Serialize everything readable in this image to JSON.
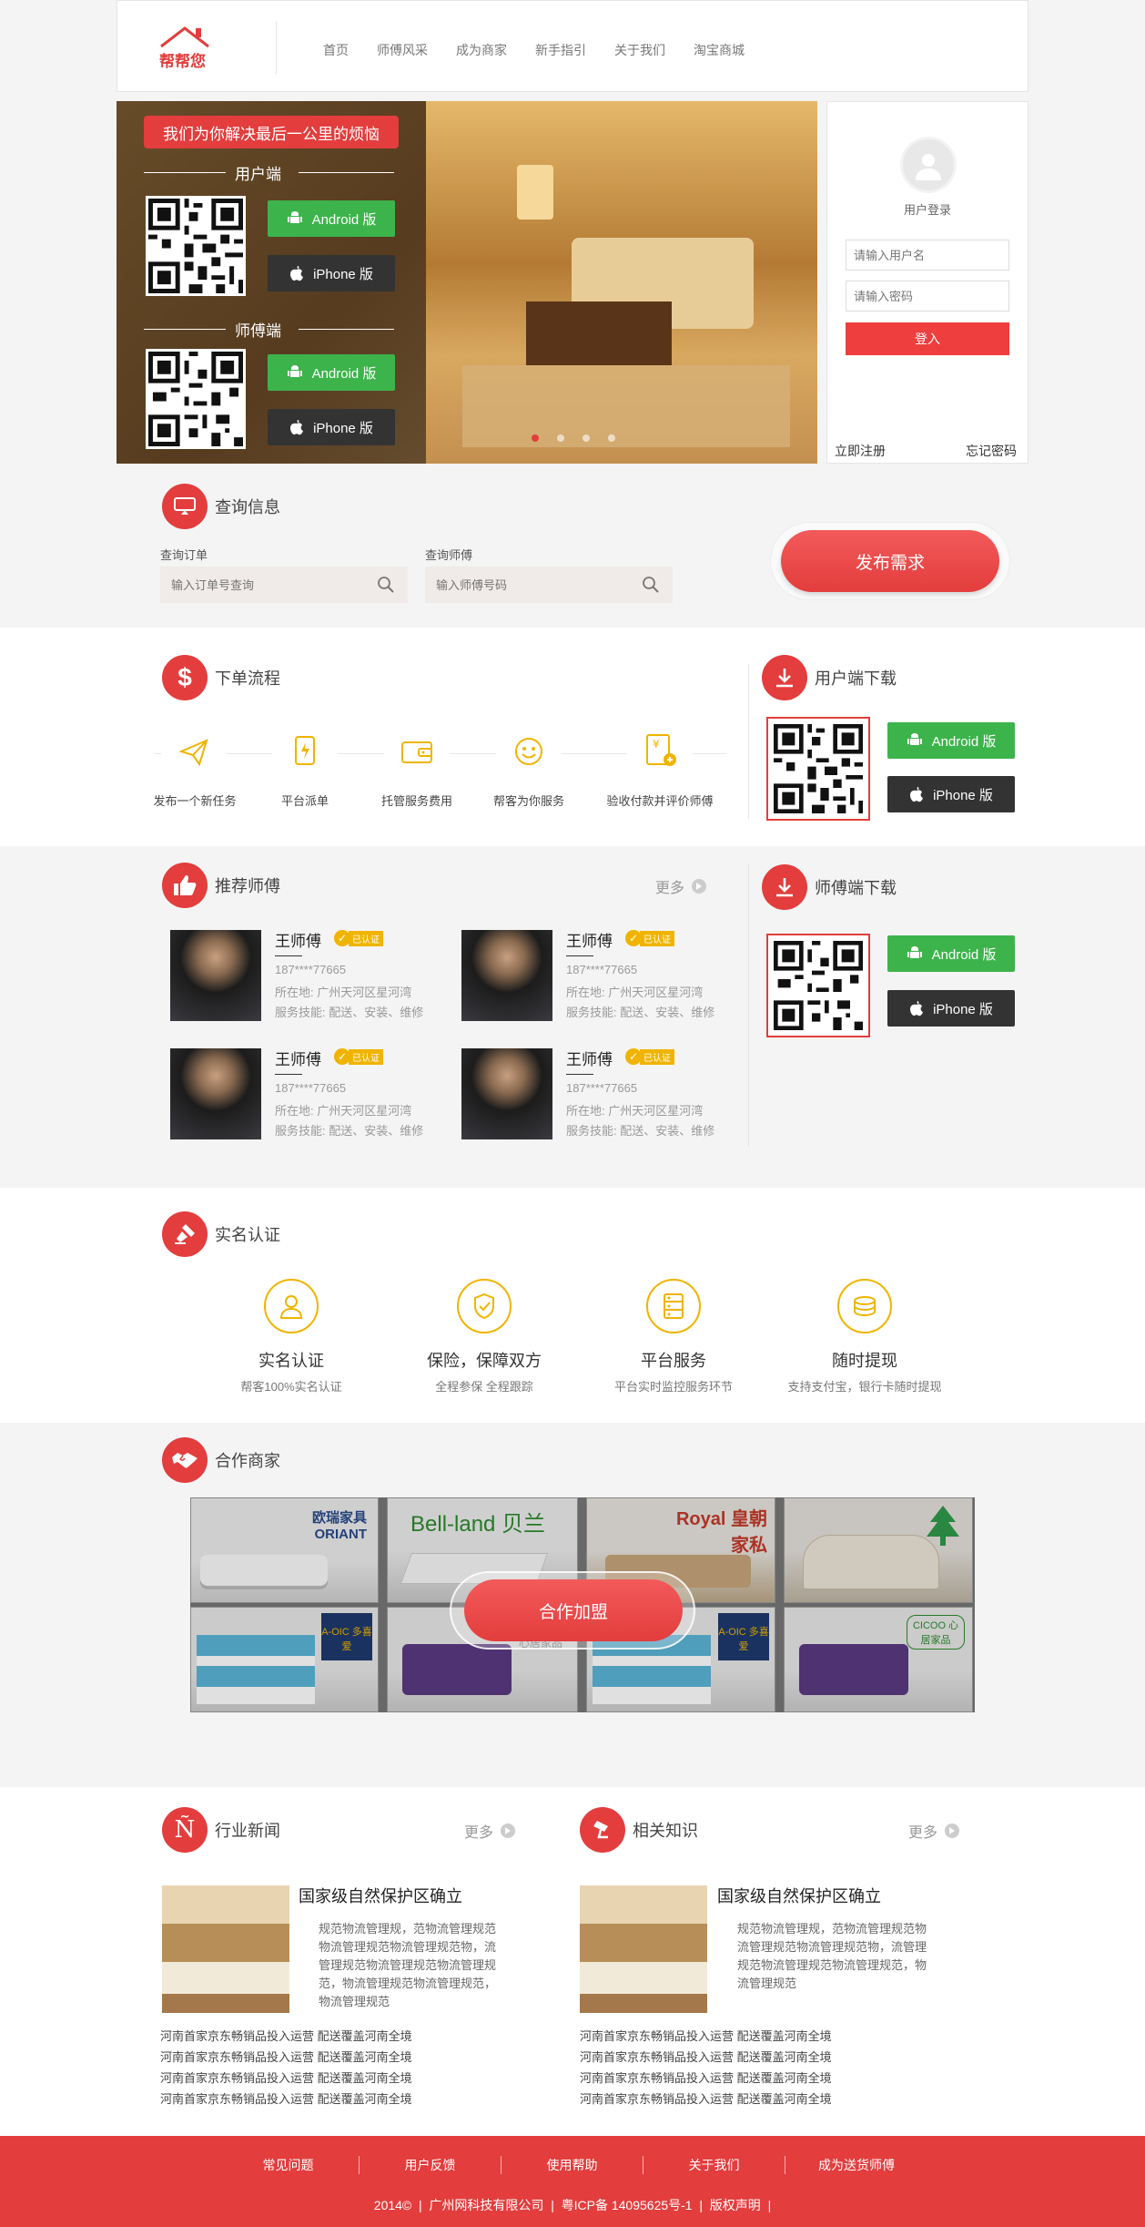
{
  "header": {
    "logo_text": "帮帮您",
    "nav": [
      "首页",
      "师傅风采",
      "成为商家",
      "新手指引",
      "关于我们",
      "淘宝商城"
    ]
  },
  "banner": {
    "slogan": "我们为你解决最后一公里的烦恼",
    "user_side": "用户端",
    "master_side": "师傅端",
    "android": "Android 版",
    "iphone": "iPhone 版"
  },
  "login": {
    "title": "用户登录",
    "username_placeholder": "请输入用户名",
    "password_placeholder": "请输入密码",
    "login_button": "登入",
    "register": "立即注册",
    "forgot": "忘记密码"
  },
  "query": {
    "title": "查询信息",
    "order_label": "查询订单",
    "order_placeholder": "输入订单号查询",
    "master_label": "查询师傅",
    "master_placeholder": "输入师傅号码",
    "publish_button": "发布需求"
  },
  "process": {
    "title": "下单流程",
    "steps": [
      "发布一个新任务",
      "平台派单",
      "托管服务费用",
      "帮客为你服务",
      "验收付款并评价师傅"
    ]
  },
  "user_download": {
    "title": "用户端下载",
    "android": "Android 版",
    "iphone": "iPhone 版"
  },
  "master_download": {
    "title": "师傅端下载",
    "android": "Android 版",
    "iphone": "iPhone 版"
  },
  "recommend": {
    "title": "推荐师傅",
    "more": "更多",
    "masters": [
      {
        "name": "王师傅",
        "badge": "已认证",
        "phone": "187****77665",
        "location": "所在地: 广州天河区星河湾",
        "skills": "服务技能: 配送、安装、维修"
      },
      {
        "name": "王师傅",
        "badge": "已认证",
        "phone": "187****77665",
        "location": "所在地: 广州天河区星河湾",
        "skills": "服务技能: 配送、安装、维修"
      },
      {
        "name": "王师傅",
        "badge": "已认证",
        "phone": "187****77665",
        "location": "所在地: 广州天河区星河湾",
        "skills": "服务技能: 配送、安装、维修"
      },
      {
        "name": "王师傅",
        "badge": "已认证",
        "phone": "187****77665",
        "location": "所在地: 广州天河区星河湾",
        "skills": "服务技能: 配送、安装、维修"
      }
    ]
  },
  "certification": {
    "title": "实名认证",
    "items": [
      {
        "title": "实名认证",
        "desc": "帮客100%实名认证"
      },
      {
        "title": "保险，保障双方",
        "desc": "全程参保 全程跟踪"
      },
      {
        "title": "平台服务",
        "desc": "平台实时监控服务环节"
      },
      {
        "title": "随时提现",
        "desc": "支持支付宝，银行卡随时提现"
      }
    ]
  },
  "partners": {
    "title": "合作商家",
    "join_button": "合作加盟",
    "brands": [
      "欧瑞家具 ORIANT",
      "Bell-land 贝兰",
      "Royal 皇朝家私",
      "",
      "A-OIC 多喜爱",
      "心居家品",
      "A-OIC 多喜爱",
      "CICOO 心居家品"
    ]
  },
  "industry_news": {
    "title": "行业新闻",
    "more": "更多",
    "headline": "国家级自然保护区确立",
    "summary": "规范物流管理规，范物流管理规范物流管理规范物流管理规范物，流管理规范物流管理规范物流管理规范，物流管理规范物流管理规范，物流管理规范",
    "items": [
      "河南首家京东畅销品投入运营 配送覆盖河南全境",
      "河南首家京东畅销品投入运营 配送覆盖河南全境",
      "河南首家京东畅销品投入运营 配送覆盖河南全境",
      "河南首家京东畅销品投入运营 配送覆盖河南全境"
    ]
  },
  "knowledge": {
    "title": "相关知识",
    "more": "更多",
    "headline": "国家级自然保护区确立",
    "summary": "规范物流管理规，范物流管理规范物流管理规范物流管理规范物，流管理规范物流管理规范物流管理规范，物流管理规范",
    "items": [
      "河南首家京东畅销品投入运营 配送覆盖河南全境",
      "河南首家京东畅销品投入运营 配送覆盖河南全境",
      "河南首家京东畅销品投入运营 配送覆盖河南全境",
      "河南首家京东畅销品投入运营 配送覆盖河南全境"
    ]
  },
  "footer": {
    "links": [
      "常见问题",
      "用户反馈",
      "使用帮助",
      "关于我们",
      "成为送货师傅"
    ],
    "copyright": "2014©  |  广州网科技有限公司  |  粤ICP备 14095625号-1  |  版权声明  |"
  },
  "colors": {
    "accent": "#e33d3d",
    "android": "#3cb44b",
    "iphone": "#333333",
    "gold": "#f0b400"
  }
}
